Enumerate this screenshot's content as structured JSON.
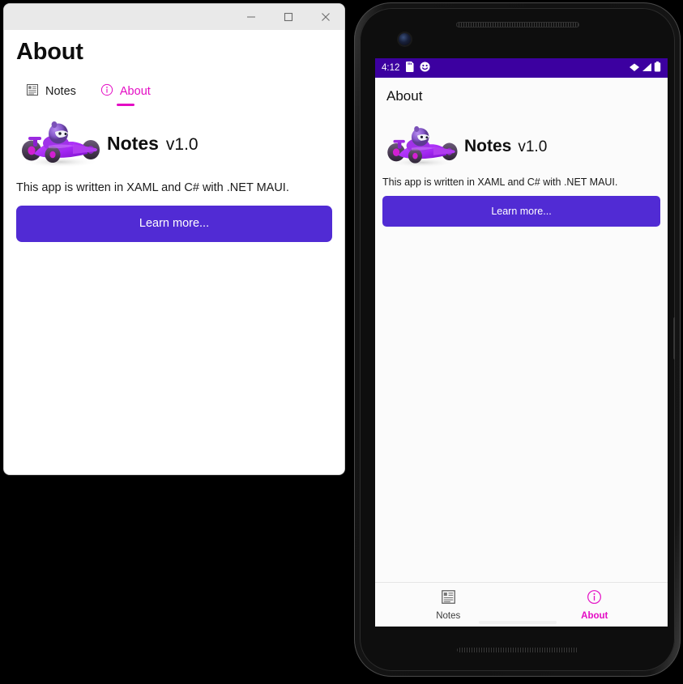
{
  "desktop": {
    "titlebar": {
      "minimize_label": "Minimize",
      "maximize_label": "Maximize",
      "close_label": "Close"
    },
    "page_title": "About",
    "tabs": [
      {
        "label": "Notes",
        "icon": "notes-list-icon",
        "active": false
      },
      {
        "label": "About",
        "icon": "info-circle-icon",
        "active": true
      }
    ],
    "hero": {
      "logo_icon": "dotnet-bot-race-car-logo",
      "app_name": "Notes",
      "version": "v1.0"
    },
    "description": "This app is written in XAML and C# with .NET MAUI.",
    "learn_more_label": "Learn more..."
  },
  "phone": {
    "statusbar": {
      "time": "4:12",
      "left_icons": [
        "sd-card-icon",
        "emoji-smiley-icon"
      ],
      "right_icons": [
        "wifi-icon",
        "cellular-signal-icon",
        "battery-icon"
      ]
    },
    "appbar_title": "About",
    "hero": {
      "logo_icon": "dotnet-bot-race-car-logo",
      "app_name": "Notes",
      "version": "v1.0"
    },
    "description": "This app is written in XAML and C# with .NET MAUI.",
    "learn_more_label": "Learn more...",
    "tabs": [
      {
        "label": "Notes",
        "icon": "notes-list-icon",
        "active": false
      },
      {
        "label": "About",
        "icon": "info-circle-icon",
        "active": true
      }
    ]
  },
  "colors": {
    "accent_purple": "#512BD4",
    "accent_magenta": "#E40CC4",
    "statusbar_purple": "#3C00A0",
    "titlebar_gray": "#E9E9E9",
    "screen_background": "#FBFBFB"
  }
}
